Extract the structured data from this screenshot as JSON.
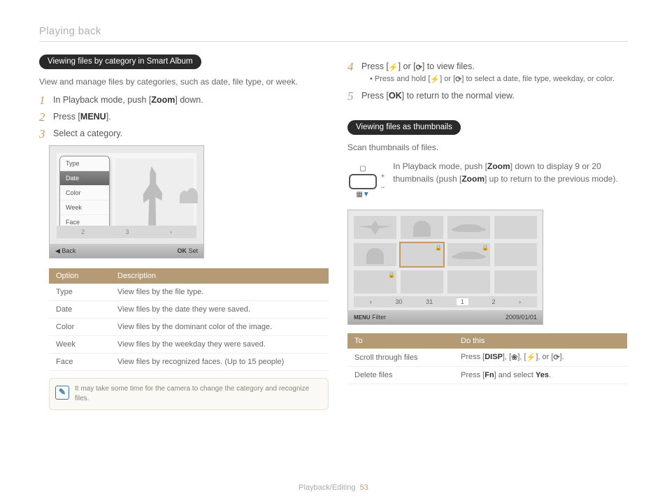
{
  "header": {
    "section": "Playing back"
  },
  "left": {
    "pill": "Viewing files by category in Smart Album",
    "intro": "View and manage files by categories, such as date, file type, or week.",
    "steps": [
      {
        "pre": "In Playback mode, push [",
        "bold": "Zoom",
        "post": "] down."
      },
      {
        "pre": "Press [",
        "bold": "MENU",
        "post": "]."
      },
      {
        "pre": "Select a category.",
        "bold": "",
        "post": ""
      }
    ],
    "menu": [
      "Type",
      "Date",
      "Color",
      "Week",
      "Face"
    ],
    "menu_selected_index": 1,
    "datebar": [
      "2",
      "3",
      "›"
    ],
    "ss_footer": {
      "back": "◀  Back",
      "set": "Set",
      "ok": "OK"
    },
    "table": {
      "headers": [
        "Option",
        "Description"
      ],
      "rows": [
        [
          "Type",
          "View files by the file type."
        ],
        [
          "Date",
          "View files by the date they were saved."
        ],
        [
          "Color",
          "View files by the dominant color of the image."
        ],
        [
          "Week",
          "View files by the weekday they were saved."
        ],
        [
          "Face",
          "View files by recognized faces. (Up to 15 people)"
        ]
      ]
    },
    "note": "It may take some time for the camera to change the category and recognize files."
  },
  "right": {
    "steps45": [
      {
        "num": "4",
        "text_parts": [
          "Press [",
          "icon-flash",
          "] or [",
          "icon-timer",
          "] to view files."
        ],
        "sub": "Press and hold [icon] or [icon] to select a date, file type, weekday, or color."
      },
      {
        "num": "5",
        "text_parts": [
          "Press [",
          "OK",
          "] to return to the normal view."
        ]
      }
    ],
    "pill": "Viewing files as thumbnails",
    "scan_text": "Scan thumbnails of files.",
    "zoom_instr_pre": "In Playback mode, push [",
    "zoom_instr_b1": "Zoom",
    "zoom_instr_mid": "] down to display 9 or 20 thumbnails (push [",
    "zoom_instr_b2": "Zoom",
    "zoom_instr_post": "] up to return to the previous mode).",
    "tg_datebar": [
      "‹",
      "30",
      "31",
      "1",
      "2",
      "›"
    ],
    "tg_footer": {
      "filter": "Filter",
      "menu": "MENU",
      "date": "2009/01/01"
    },
    "table": {
      "headers": [
        "To",
        "Do this"
      ],
      "rows": [
        {
          "to": "Scroll through files",
          "do_pre": "Press [",
          "b1": "DISP",
          "do_mid": "], [icon], [icon], or [icon].",
          "do_post": ""
        },
        {
          "to": "Delete files",
          "do_pre": "Press [",
          "b1": "Fn",
          "do_mid": "] and select ",
          "b2": "Yes",
          "do_post": "."
        }
      ]
    }
  },
  "footer": {
    "section": "Playback/Editing",
    "page": "53"
  }
}
